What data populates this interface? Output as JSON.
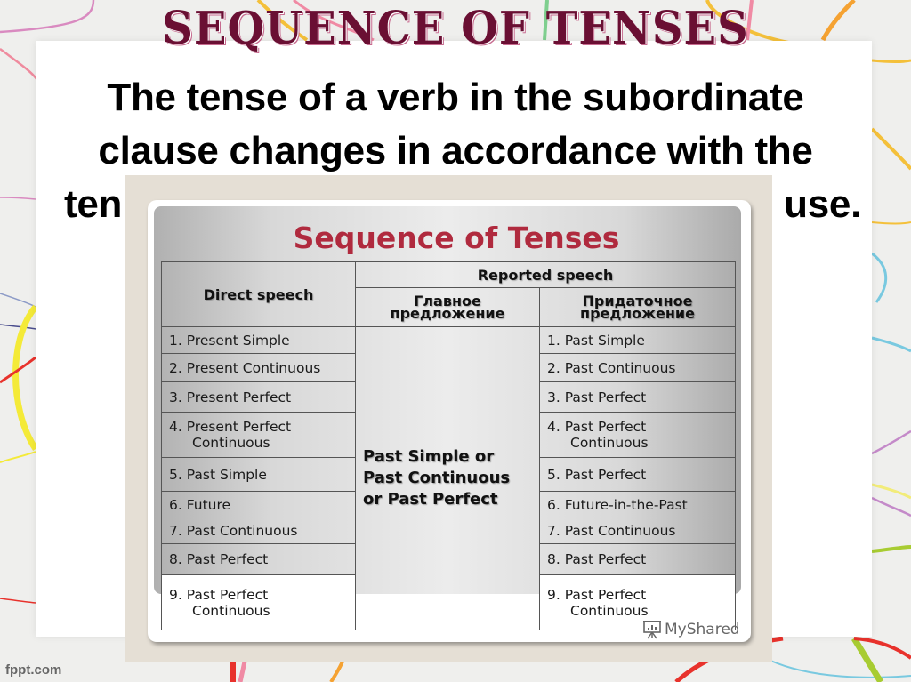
{
  "slide": {
    "title": "SEQUENCE OF TENSES",
    "body_lines": [
      "The tense of a verb in the subordinate",
      "clause changes in accordance with the",
      "tense of the verb in the principal clause."
    ],
    "body_visible_fragments": {
      "line3_left": "ten",
      "line3_right": "use."
    },
    "title_color": "#6a0f33"
  },
  "embedded_image": {
    "title": "Sequence of Tenses",
    "title_color": "#b02a3e",
    "table": {
      "header_direct": "Direct speech",
      "header_reported": "Reported speech",
      "header_main_clause": "Главное предложение",
      "header_subordinate_clause_line1": "Придаточное",
      "header_subordinate_clause_line2": "предложение",
      "main_clause_value": [
        "Past Simple or",
        "Past Continuous",
        "or Past Perfect"
      ],
      "rows": [
        {
          "direct": "1.  Present Simple",
          "direct_cont": "",
          "reported": "1. Past Simple",
          "reported_cont": ""
        },
        {
          "direct": "2. Present Continuous",
          "direct_cont": "",
          "reported": "2. Past Continuous",
          "reported_cont": ""
        },
        {
          "direct": "3. Present Perfect",
          "direct_cont": "",
          "reported": "3. Past Perfect",
          "reported_cont": ""
        },
        {
          "direct": "4. Present Perfect",
          "direct_cont": "Continuous",
          "reported": "4. Past Perfect",
          "reported_cont": "Continuous"
        },
        {
          "direct": "5. Past Simple",
          "direct_cont": "",
          "reported": "5. Past Perfect",
          "reported_cont": ""
        },
        {
          "direct": "6. Future",
          "direct_cont": "",
          "reported": "6. Future-in-the-Past",
          "reported_cont": ""
        },
        {
          "direct": "7. Past Continuous",
          "direct_cont": "",
          "reported": "7. Past Continuous",
          "reported_cont": ""
        },
        {
          "direct": "8. Past Perfect",
          "direct_cont": "",
          "reported": "8. Past Perfect",
          "reported_cont": ""
        },
        {
          "direct": "9. Past Perfect",
          "direct_cont": "Continuous",
          "reported": "9. Past Perfect",
          "reported_cont": "Continuous"
        }
      ]
    },
    "watermark": "MyShared",
    "watermark_icon": "presentation-chart-icon"
  },
  "footer": {
    "site": "fppt.com"
  }
}
